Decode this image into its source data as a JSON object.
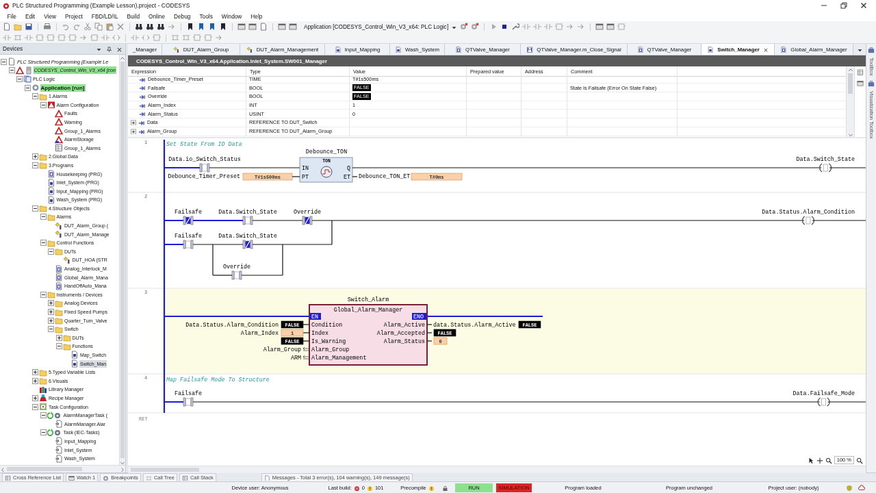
{
  "window": {
    "title": "PLC Structured Programming (Example Lesson).project - CODESYS"
  },
  "menu": [
    "File",
    "Edit",
    "View",
    "Project",
    "FBD/LD/IL",
    "Build",
    "Online",
    "Debug",
    "Tools",
    "Window",
    "Help"
  ],
  "toolbar": {
    "active_application": "Application [CODESYS_Control_Win_V3_x64: PLC Logic]"
  },
  "devices": {
    "title": "Devices",
    "tree": [
      {
        "label": "PLC Structured Programming (Example Le",
        "kind": "project",
        "online": false,
        "selected": false,
        "expanded": true,
        "children": [
          {
            "label": "CODESYS_Control_Win_V3_x64 [con",
            "kind": "device",
            "online": true,
            "selected": false,
            "expanded": true,
            "children": [
              {
                "label": "PLC Logic",
                "kind": "plc",
                "online": false,
                "selected": false,
                "expanded": true,
                "children": [
                  {
                    "label": "Application [run]",
                    "kind": "application",
                    "online": true,
                    "selected": false,
                    "expanded": true,
                    "children": [
                      {
                        "label": "1.Alarms",
                        "kind": "folder",
                        "online": false,
                        "selected": false,
                        "expanded": true,
                        "children": [
                          {
                            "label": "Alarm Configuration",
                            "kind": "alarm-config",
                            "online": false,
                            "selected": false,
                            "expanded": true,
                            "children": [
                              {
                                "label": "Faults",
                                "kind": "alarm",
                                "online": false,
                                "selected": false
                              },
                              {
                                "label": "Warning",
                                "kind": "alarm",
                                "online": false,
                                "selected": false
                              },
                              {
                                "label": "Group_1_Alarms",
                                "kind": "alarm",
                                "online": false,
                                "selected": false
                              },
                              {
                                "label": "AlarmStorage",
                                "kind": "alarm-storage",
                                "online": false,
                                "selected": false
                              },
                              {
                                "label": "Group_1_Alarms",
                                "kind": "list",
                                "online": false,
                                "selected": false
                              }
                            ]
                          }
                        ]
                      },
                      {
                        "label": "2.Global Data",
                        "kind": "folder",
                        "online": false,
                        "selected": false,
                        "expanded": false
                      },
                      {
                        "label": "3.Programs",
                        "kind": "folder",
                        "online": false,
                        "selected": false,
                        "expanded": true,
                        "children": [
                          {
                            "label": "Housekeeping (PRG)",
                            "kind": "fb",
                            "online": false,
                            "selected": false
                          },
                          {
                            "label": "Inlet_System (PRG)",
                            "kind": "prg",
                            "online": false,
                            "selected": false
                          },
                          {
                            "label": "Input_Mapping (PRG)",
                            "kind": "prg",
                            "online": false,
                            "selected": false
                          },
                          {
                            "label": "Wash_System (PRG)",
                            "kind": "prg",
                            "online": false,
                            "selected": false
                          }
                        ]
                      },
                      {
                        "label": "4.Structure Objects",
                        "kind": "folder",
                        "online": false,
                        "selected": false,
                        "expanded": true,
                        "children": [
                          {
                            "label": "Alarms",
                            "kind": "folder",
                            "online": false,
                            "selected": false,
                            "expanded": true,
                            "children": [
                              {
                                "label": "DUT_Alarm_Group (",
                                "kind": "dut",
                                "online": false,
                                "selected": false
                              },
                              {
                                "label": "DUT_Alarm_Manage",
                                "kind": "dut",
                                "online": false,
                                "selected": false
                              }
                            ]
                          },
                          {
                            "label": "Control Functions",
                            "kind": "folder",
                            "online": false,
                            "selected": false,
                            "expanded": true,
                            "children": [
                              {
                                "label": "DUTs",
                                "kind": "folder",
                                "online": false,
                                "selected": false,
                                "expanded": true,
                                "children": [
                                  {
                                    "label": "DUT_HOA (STR",
                                    "kind": "dut",
                                    "online": false,
                                    "selected": false
                                  }
                                ]
                              },
                              {
                                "label": "Analog_Interlock_M",
                                "kind": "fb",
                                "online": false,
                                "selected": false
                              },
                              {
                                "label": "Global_Alarm_Mana",
                                "kind": "fb",
                                "online": false,
                                "selected": false
                              },
                              {
                                "label": "HandOffAuto_Mana",
                                "kind": "fb",
                                "online": false,
                                "selected": false
                              }
                            ]
                          },
                          {
                            "label": "Instruments / Devices",
                            "kind": "folder",
                            "online": false,
                            "selected": false,
                            "expanded": true,
                            "children": [
                              {
                                "label": "Analog Devices",
                                "kind": "folder",
                                "online": false,
                                "selected": false,
                                "expanded": false
                              },
                              {
                                "label": "Fixed Speed Pumps",
                                "kind": "folder",
                                "online": false,
                                "selected": false,
                                "expanded": false
                              },
                              {
                                "label": "Quarter_Turn_Valve",
                                "kind": "folder",
                                "online": false,
                                "selected": false,
                                "expanded": false
                              },
                              {
                                "label": "Switch",
                                "kind": "folder",
                                "online": false,
                                "selected": false,
                                "expanded": true,
                                "children": [
                                  {
                                    "label": "DUTs",
                                    "kind": "folder",
                                    "online": false,
                                    "selected": false,
                                    "expanded": false
                                  },
                                  {
                                    "label": "Functions",
                                    "kind": "folder",
                                    "online": false,
                                    "selected": false,
                                    "expanded": true,
                                    "children": [
                                      {
                                        "label": "Map_Switch",
                                        "kind": "prg",
                                        "online": false,
                                        "selected": false
                                      },
                                      {
                                        "label": "Switch_Man",
                                        "kind": "prg",
                                        "online": false,
                                        "selected": true
                                      }
                                    ]
                                  }
                                ]
                              }
                            ]
                          }
                        ]
                      },
                      {
                        "label": "5.Typed Variable Lists",
                        "kind": "folder",
                        "online": false,
                        "selected": false,
                        "expanded": false
                      },
                      {
                        "label": "6.Visuals",
                        "kind": "folder",
                        "online": false,
                        "selected": false,
                        "expanded": false
                      },
                      {
                        "label": "Library Manager",
                        "kind": "library",
                        "online": false,
                        "selected": false
                      },
                      {
                        "label": "Recipe Manager",
                        "kind": "recipe",
                        "online": false,
                        "selected": false,
                        "expanded": false
                      },
                      {
                        "label": "Task Configuration",
                        "kind": "task-config",
                        "online": false,
                        "selected": false,
                        "expanded": true,
                        "children": [
                          {
                            "label": "AlarmManagerTask (",
                            "kind": "task",
                            "online": false,
                            "selected": false,
                            "expanded": true,
                            "children": [
                              {
                                "label": "AlarmManager.Alar",
                                "kind": "call",
                                "online": false,
                                "selected": false
                              }
                            ]
                          },
                          {
                            "label": "Task (IEC-Tasks)",
                            "kind": "task",
                            "online": false,
                            "selected": false,
                            "expanded": true,
                            "children": [
                              {
                                "label": "Input_Mapping",
                                "kind": "call",
                                "online": false,
                                "selected": false
                              },
                              {
                                "label": "Inlet_System",
                                "kind": "call",
                                "online": false,
                                "selected": false
                              },
                              {
                                "label": "Wash_System",
                                "kind": "call",
                                "online": false,
                                "selected": false
                              }
                            ]
                          }
                        ]
                      }
                    ]
                  }
                ]
              }
            ]
          }
        ]
      }
    ]
  },
  "editor": {
    "tabs": [
      {
        "label": "_Manager",
        "kind": "clipped",
        "selected": false
      },
      {
        "label": "DUT_Alarm_Group",
        "kind": "dut",
        "selected": false
      },
      {
        "label": "DUT_Alarm_Management",
        "kind": "dut",
        "selected": false
      },
      {
        "label": "Input_Mapping",
        "kind": "prg",
        "selected": false
      },
      {
        "label": "Wash_System",
        "kind": "prg",
        "selected": false
      },
      {
        "label": "QTValve_Manager",
        "kind": "fb",
        "selected": false
      },
      {
        "label": "QTValve_Manager.m_Close_Signal",
        "kind": "method",
        "selected": false
      },
      {
        "label": "QTValve_Manager",
        "kind": "fb",
        "selected": false
      },
      {
        "label": "Switch_Manager",
        "kind": "prg",
        "selected": true
      },
      {
        "label": "Global_Alarm_Manager",
        "kind": "fb",
        "selected": false
      }
    ],
    "path": "CODESYS_Control_Win_V3_x64.Application.Inlet_System.SW001_Manager",
    "variables": {
      "columns": [
        "Expression",
        "Type",
        "Value",
        "Prepared value",
        "Address",
        "Comment"
      ],
      "rows": [
        {
          "expression": "Debounce_Timer_Preset",
          "type": "TIME",
          "value": "T#1s500ms",
          "kind": "plain"
        },
        {
          "expression": "Failsafe",
          "type": "BOOL",
          "value": "FALSE",
          "kind": "bool",
          "comment": "State Is Failsafe (Error On State False)"
        },
        {
          "expression": "Override",
          "type": "BOOL",
          "value": "FALSE",
          "kind": "bool"
        },
        {
          "expression": "Alarm_Index",
          "type": "INT",
          "value": "1",
          "kind": "plain"
        },
        {
          "expression": "Alarm_Status",
          "type": "USINT",
          "value": "0",
          "kind": "plain"
        },
        {
          "expression": "Data",
          "type": "REFERENCE TO DUT_Switch",
          "expanded": false
        },
        {
          "expression": "Alarm_Group",
          "type": "REFERENCE TO DUT_Alarm_Group",
          "expanded": false
        }
      ]
    }
  },
  "ladder": {
    "rungs": [
      {
        "number": "1",
        "kind": "timer",
        "selected": false,
        "comment": "Set State From IO Data",
        "input": {
          "label": "Data.io_Switch_Status",
          "negated": false,
          "energized": false
        },
        "block": {
          "instance": "Debounce_TON",
          "type": "TON",
          "inputs": [
            "IN",
            "PT"
          ],
          "outputs": [
            "Q",
            "ET"
          ]
        },
        "preset": {
          "label": "Debounce_Timer_Preset",
          "value": "T#1s500ms"
        },
        "elapsed": {
          "label": "Debounce_TON_ET",
          "value": "T#0ms"
        },
        "coil": {
          "label": "Data.Switch_State",
          "energized": false
        }
      },
      {
        "number": "2",
        "kind": "contacts",
        "selected": false,
        "branches": [
          [
            {
              "label": "Failsafe",
              "negated": true,
              "energized": true
            },
            {
              "label": "Data.Switch_State",
              "negated": false,
              "energized": false
            },
            {
              "label": "Override",
              "negated": true,
              "energized": true
            }
          ],
          [
            {
              "label": "Failsafe",
              "negated": false,
              "energized": false
            },
            {
              "label": "Data.Switch_State",
              "negated": true,
              "energized": true
            }
          ]
        ],
        "parallel": {
          "label": "Override",
          "negated": false,
          "energized": false
        },
        "coil": {
          "label": "Data.Status.Alarm_Condition",
          "energized": false
        }
      },
      {
        "number": "3",
        "kind": "function_block",
        "selected": true,
        "instance": "Switch_Alarm",
        "type": "Global_Alarm_Manager",
        "enabled": true,
        "en": "EN",
        "eno": "ENO",
        "inputs": [
          {
            "pin": "Condition",
            "variable": "Data.Status.Alarm_Condition",
            "value": "FALSE",
            "kind": "bool"
          },
          {
            "pin": "Index",
            "variable": "Alarm_Index",
            "value": "1",
            "kind": "number"
          },
          {
            "pin": "Is_Warning",
            "value": "FALSE",
            "kind": "bool"
          },
          {
            "pin": "Alarm_Group",
            "variable": "Alarm_Group",
            "kind": "reference"
          },
          {
            "pin": "Alarm_Management",
            "variable": "ARM",
            "kind": "reference"
          }
        ],
        "outputs": [
          {
            "pin": "Alarm_Active",
            "variable": "data.Status.Alarm_Active",
            "value": "FALSE",
            "kind": "bool"
          },
          {
            "pin": "Alarm_Accepted",
            "value": "FALSE",
            "kind": "bool"
          },
          {
            "pin": "Alarm_Status",
            "value": "0",
            "kind": "number"
          }
        ]
      },
      {
        "number": "4",
        "kind": "contact_coil",
        "selected": false,
        "comment": "Map Failsafe Mode To Structure",
        "contact": {
          "label": "Failsafe",
          "negated": false,
          "energized": false
        },
        "coil": {
          "label": "Data.Failsafe_Mode",
          "energized": false
        }
      }
    ],
    "end_label": "RET",
    "zoom": "100 %"
  },
  "side_tabs": [
    "ToolBox",
    "Visualization Toolbox"
  ],
  "bottom_tabs": [
    "Cross Reference List",
    "Watch 1",
    "Breakpoints",
    "Call Tree",
    "Call Stack",
    "Messages - Total 3 error(s), 104 warning(s), 149 message(s)"
  ],
  "status_bar": {
    "device_user": "Device user: Anonymous",
    "last_build": "Last build:",
    "errors": "0",
    "warnings": "101",
    "precompile": "Precompile",
    "run": "RUN",
    "simulation": "SIMULATION",
    "program_state": "Program loaded",
    "change_state": "Program unchanged",
    "project_user": "Project user: (nobody)"
  }
}
